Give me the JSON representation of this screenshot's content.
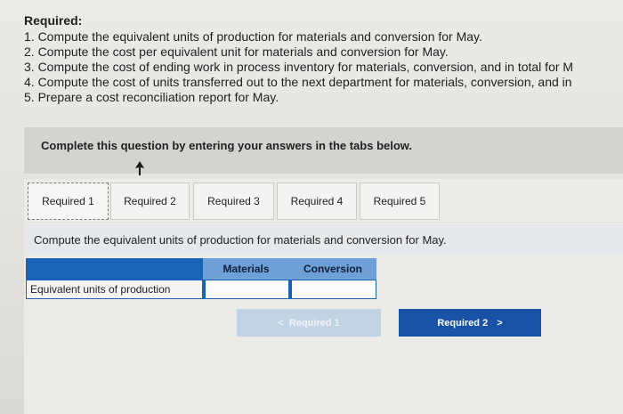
{
  "requirements": {
    "title": "Required:",
    "items": [
      "1. Compute the equivalent units of production for materials and conversion for May.",
      "2. Compute the cost per equivalent unit for materials and conversion for May.",
      "3. Compute the cost of ending work in process inventory for materials, conversion, and in total for M",
      "4. Compute the cost of units transferred out to the next department for materials, conversion, and in",
      "5. Prepare a cost reconciliation report for May."
    ]
  },
  "instruction": "Complete this question by entering your answers in the tabs below.",
  "tabs": [
    {
      "label": "Required 1"
    },
    {
      "label": "Required 2"
    },
    {
      "label": "Required 3"
    },
    {
      "label": "Required 4"
    },
    {
      "label": "Required 5"
    }
  ],
  "question": "Compute the equivalent units of production for materials and conversion for May.",
  "table": {
    "columns": [
      "Materials",
      "Conversion"
    ],
    "row_label": "Equivalent units of production",
    "values": [
      "",
      ""
    ]
  },
  "navigation": {
    "prev_label": "Required 1",
    "prev_arrow": "<",
    "next_label": "Required 2",
    "next_arrow": ">"
  },
  "colors": {
    "header_blue": "#1b63b6",
    "button_blue": "#1752a6",
    "disabled_button": "#c3d3e6"
  }
}
